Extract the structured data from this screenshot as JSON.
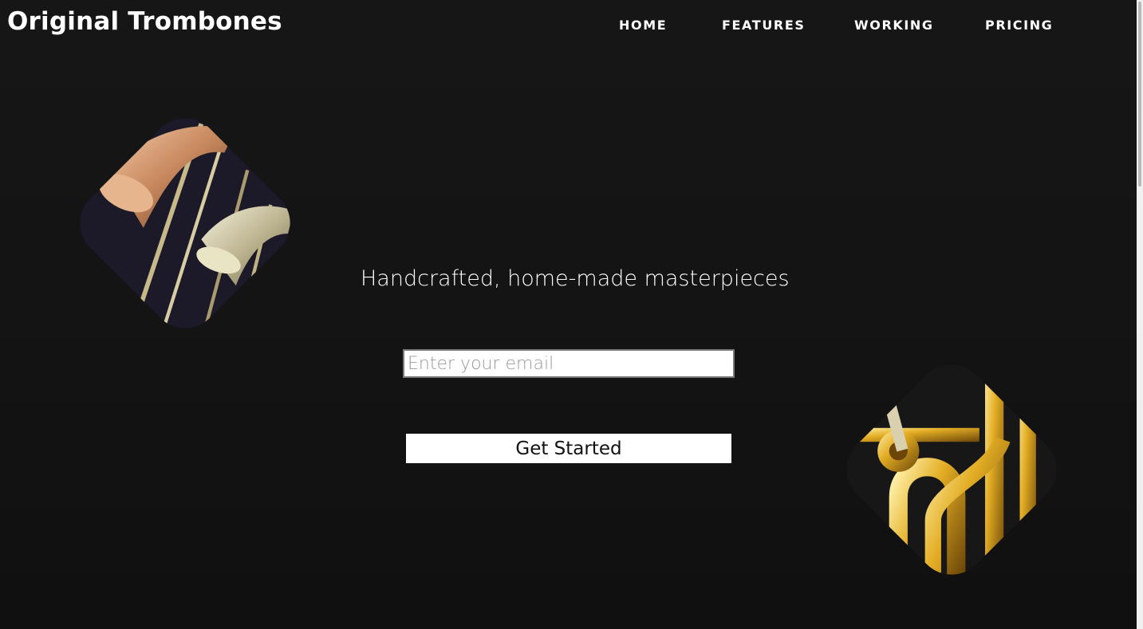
{
  "brand": {
    "name": "Original Trombones"
  },
  "nav": {
    "items": [
      "HOME",
      "FEATURES",
      "WORKING",
      "PRICING"
    ]
  },
  "hero": {
    "tagline": "Handcrafted, home-made masterpieces",
    "email_placeholder": "Enter your email",
    "email_value": "",
    "cta_label": "Get Started"
  },
  "images": [
    {
      "alt": "trombone-bells-photo"
    },
    {
      "alt": "trombone-slide-brass-photo"
    }
  ],
  "colors": {
    "background": "#121212",
    "text": "#ffffff",
    "button_bg": "#ffffff",
    "brass": "#d9a21e",
    "copper": "#c98a5f"
  }
}
